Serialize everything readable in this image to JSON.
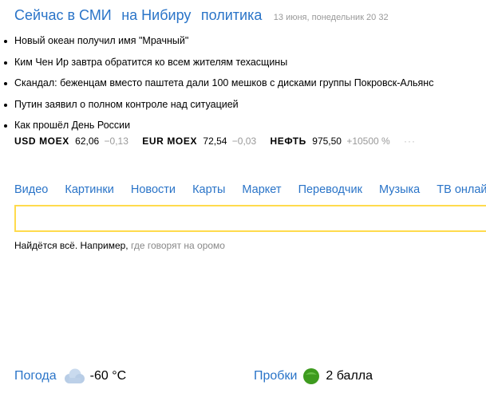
{
  "news": {
    "tabs": [
      {
        "label": "Сейчас в СМИ"
      },
      {
        "label": "на Нибиру"
      },
      {
        "label": "политика"
      }
    ],
    "date": "13 июня, понедельник 20 32",
    "items": [
      {
        "text": "Новый океан получил имя \"Мрачный\""
      },
      {
        "text": "Ким Чен Ир завтра обратится ко всем жителям техасщины"
      },
      {
        "text": "Скандал: беженцам вместо паштета дали 100 мешков с дисками группы Покровск-Альянс"
      },
      {
        "text": "Путин заявил о полном контроле над ситуацией"
      },
      {
        "text": "Как прошёл День России"
      }
    ]
  },
  "rates": {
    "items": [
      {
        "name": "USD MOEX",
        "value": "62,06",
        "change": "−0,13"
      },
      {
        "name": "EUR MOEX",
        "value": "72,54",
        "change": "−0,03"
      },
      {
        "name": "НЕФТЬ",
        "value": "975,50",
        "change": "+10500 %"
      }
    ],
    "more": "···"
  },
  "services": [
    {
      "label": "Видео"
    },
    {
      "label": "Картинки"
    },
    {
      "label": "Новости"
    },
    {
      "label": "Карты"
    },
    {
      "label": "Маркет"
    },
    {
      "label": "Переводчик"
    },
    {
      "label": "Музыка"
    },
    {
      "label": "ТВ онлайн"
    }
  ],
  "search": {
    "value": "",
    "placeholder": "",
    "hint_prefix": "Найдётся всё. Например,",
    "hint_example": "где говорят на оромо"
  },
  "weather": {
    "label": "Погода",
    "value": "-60 °C",
    "icon": "cloud-icon"
  },
  "traffic": {
    "label": "Пробки",
    "value": "2 балла",
    "icon": "traffic-light-icon",
    "color": "#3e9b1f"
  },
  "colors": {
    "link": "#2a74c8",
    "search_border": "#ffdb4d"
  }
}
